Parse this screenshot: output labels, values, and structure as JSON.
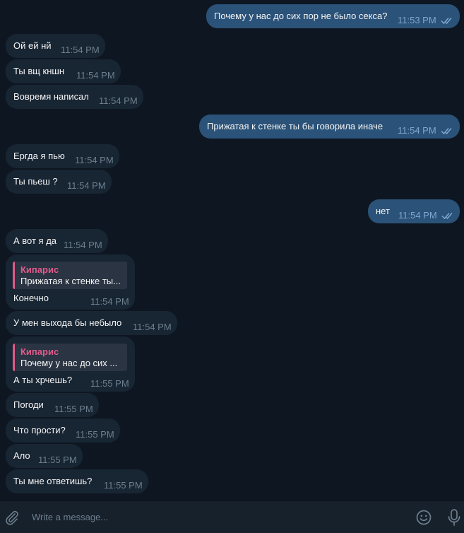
{
  "messages": [
    {
      "dir": "out",
      "text": "Почему у нас до сих пор не было секса?",
      "time": "11:53 PM",
      "read": true
    },
    {
      "dir": "in",
      "text": "Ой ей нй",
      "time": "11:54 PM"
    },
    {
      "dir": "in",
      "text": "Ты вщ кншн",
      "time": "11:54 PM"
    },
    {
      "dir": "in",
      "text": "Вовремя написал",
      "time": "11:54 PM"
    },
    {
      "dir": "out",
      "text": "Прижатая к стенке ты бы говорила иначе",
      "time": "11:54 PM",
      "read": true
    },
    {
      "dir": "in",
      "text": "Ергда я пью",
      "time": "11:54 PM"
    },
    {
      "dir": "in",
      "text": "Ты пьеш ?",
      "time": "11:54 PM"
    },
    {
      "dir": "out",
      "text": "нет",
      "time": "11:54 PM",
      "read": true
    },
    {
      "dir": "in",
      "text": "А вот я да",
      "time": "11:54 PM"
    },
    {
      "dir": "in",
      "text": "Конечно",
      "time": "11:54 PM",
      "reply": {
        "name": "Кипарис",
        "text": "Прижатая к стенке ты..."
      }
    },
    {
      "dir": "in",
      "text": "У мен выхода бы небыло",
      "time": "11:54 PM"
    },
    {
      "dir": "in",
      "text": "А ты хрчешь?",
      "time": "11:55 PM",
      "reply": {
        "name": "Кипарис",
        "text": "Почему у нас до сих ..."
      }
    },
    {
      "dir": "in",
      "text": "Погоди",
      "time": "11:55 PM"
    },
    {
      "dir": "in",
      "text": "Что прости?",
      "time": "11:55 PM"
    },
    {
      "dir": "in",
      "text": "Ало",
      "time": "11:55 PM"
    },
    {
      "dir": "in",
      "text": "Ты мне ответишь?",
      "time": "11:55 PM"
    }
  ],
  "composer": {
    "placeholder": "Write a message...",
    "icons": [
      "paperclip-icon",
      "emoji-icon",
      "microphone-icon"
    ]
  },
  "colors": {
    "background": "#0e1621",
    "incoming_bubble": "#182533",
    "outgoing_bubble": "#2b5278",
    "reply_accent": "#e05a8a",
    "composer_bg": "#17212b"
  }
}
